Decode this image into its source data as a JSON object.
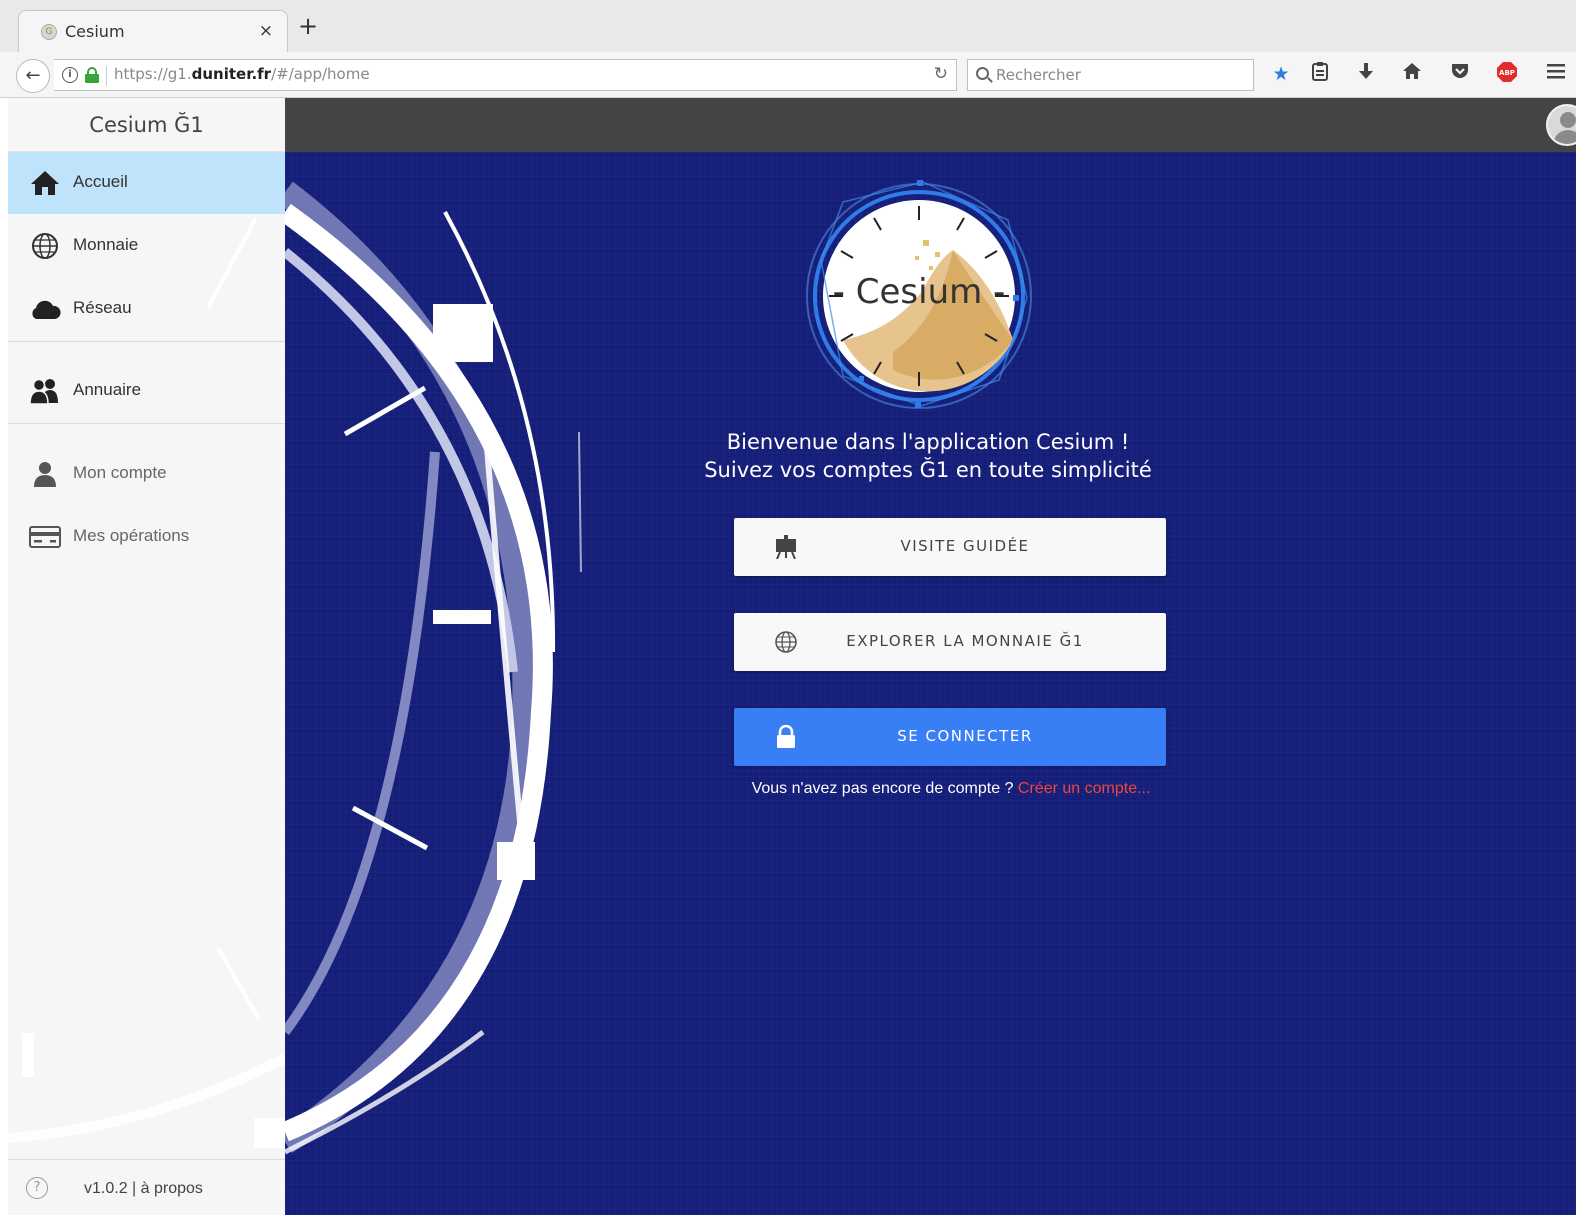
{
  "browser": {
    "tab_title": "Cesium",
    "tab_close": "×",
    "new_tab": "+",
    "url_prefix": "https://g1.",
    "url_domain": "duniter.fr",
    "url_path": "/#/app/home",
    "search_placeholder": "Rechercher",
    "toolbar_icons": [
      "bookmark-star-icon",
      "reading-list-icon",
      "download-icon",
      "home-icon",
      "pocket-icon",
      "adblock-icon",
      "menu-icon"
    ],
    "accent_star": "#2a7fe0"
  },
  "sidebar": {
    "title": "Cesium Ğ1",
    "items": [
      {
        "label": "Accueil",
        "icon": "home-icon",
        "active": true
      },
      {
        "label": "Monnaie",
        "icon": "globe-icon"
      },
      {
        "label": "Réseau",
        "icon": "cloud-icon"
      },
      {
        "label": "Annuaire",
        "icon": "people-icon"
      },
      {
        "label": "Mon compte",
        "icon": "person-icon"
      },
      {
        "label": "Mes opérations",
        "icon": "card-icon"
      }
    ],
    "footer": {
      "version": "v1.0.2 | à propos",
      "help_icon": "?"
    },
    "active_color": "#bfe3fb"
  },
  "main": {
    "logo_text": "- Cesium -",
    "welcome_line1": "Bienvenue dans l'application Cesium !",
    "welcome_line2": "Suivez vos comptes Ğ1 en toute simplicité",
    "buttons": {
      "tour": "VISITE GUIDÉE",
      "explore": "EXPLORER LA MONNAIE Ğ1",
      "login": "SE CONNECTER"
    },
    "signup_text": "Vous n'avez pas encore de compte ?",
    "signup_link": "Créer un compte...",
    "background_color": "#151f7a",
    "primary_color": "#387ef5",
    "link_color": "#ef473a"
  }
}
